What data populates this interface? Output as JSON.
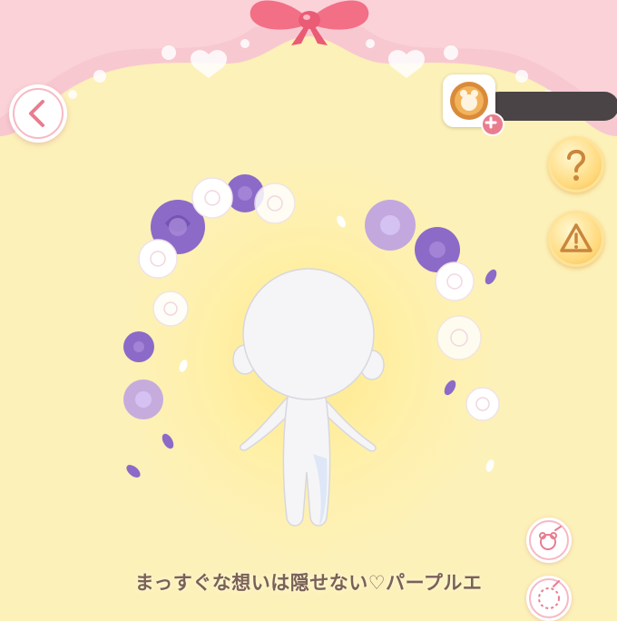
{
  "header": {
    "back_icon": "chevron-left-icon",
    "bow_icon": "pink-ribbon-bow",
    "currency": {
      "icon": "coin-icon",
      "value": "",
      "add_icon": "plus-icon"
    }
  },
  "side_buttons": {
    "help_icon": "question-mark-icon",
    "warning_icon": "warning-icon",
    "tool1_icon": "bear-pin-icon",
    "tool2_icon": "dial-icon"
  },
  "outfit": {
    "title": "まっすぐな想いは隠せない♡パープルエ"
  },
  "colors": {
    "background": "#fcf1b8",
    "curtain": "#f8c8d0",
    "accent_pink": "#e97d8f",
    "purple_rose": "#8c6ac8",
    "title_text": "#7a6158"
  }
}
